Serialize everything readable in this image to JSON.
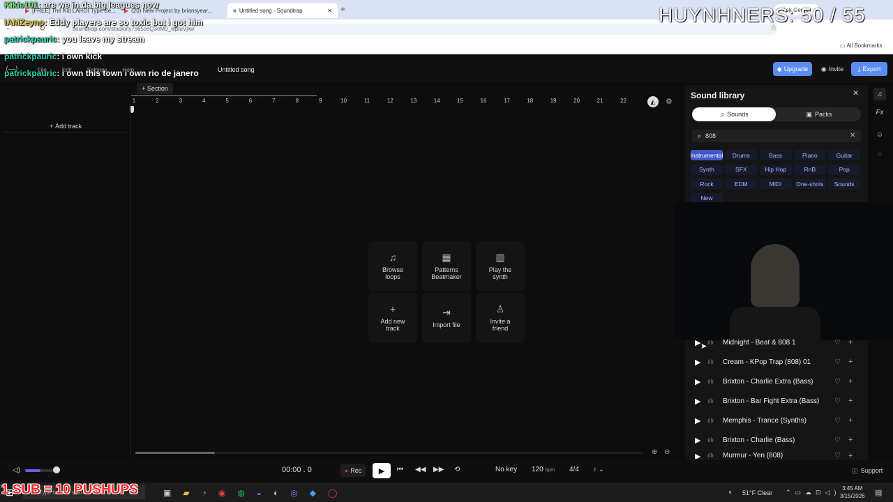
{
  "browser": {
    "tabs": [
      "[FREE] The Kid LAROI Type Be...",
      "(20) New Project by briansyear...",
      "Untitled song - Soundtrap"
    ],
    "url": "soundtrap.com/studio/ly7s65ceQ3eM0_wptuVjiw/",
    "ask_gemini": "Ask Gemini",
    "all_bookmarks": "All Bookmarks"
  },
  "app": {
    "menu": [
      "File",
      "Edit",
      "Settings",
      "Help"
    ],
    "song_title": "Untitled song",
    "upgrade": "Upgrade",
    "invite": "Invite",
    "export": "Export",
    "section": "Section",
    "add_track": "Add track",
    "ruler": [
      "1",
      "2",
      "3",
      "4",
      "5",
      "6",
      "7",
      "8",
      "9",
      "10",
      "11",
      "12",
      "13",
      "14",
      "15",
      "16",
      "17",
      "18",
      "19",
      "20",
      "21",
      "22"
    ],
    "tiles": [
      {
        "icon": "music-note-icon",
        "line1": "Browse",
        "line2": "loops"
      },
      {
        "icon": "grid-icon",
        "line1": "Patterns",
        "line2": "Beatmaker"
      },
      {
        "icon": "keyboard-icon",
        "line1": "Play the",
        "line2": "synth"
      },
      {
        "icon": "plus-icon",
        "line1": "Add new",
        "line2": "track"
      },
      {
        "icon": "import-icon",
        "line1": "Import file",
        "line2": ""
      },
      {
        "icon": "add-person-icon",
        "line1": "Invite a",
        "line2": "friend"
      }
    ]
  },
  "library": {
    "title": "Sound library",
    "tab_sounds": "Sounds",
    "tab_packs": "Packs",
    "search_value": "808",
    "chips": [
      "Instrumental",
      "Drums",
      "Bass",
      "Piano",
      "Guitar",
      "Synth",
      "SFX",
      "Hip Hop",
      "RnB",
      "Pop",
      "Rock",
      "EDM",
      "MIDI",
      "One-shots",
      "Sounds",
      "New"
    ],
    "selected_chip": "Instrumental",
    "items": [
      "Midnight - Beat & 808 1",
      "Cream - KPop Trap (808) 01",
      "Brixton - Charlie Extra (Bass)",
      "Brixton - Bar Fight Extra (Bass)",
      "Memphis - Trance (Synths)",
      "Brixton - Charlie (Bass)",
      "Murmur - Yen (808)"
    ]
  },
  "transport": {
    "time": "00:00 . 0",
    "rec": "Rec",
    "key": "No key",
    "bpm": "120",
    "bpm_unit": "bpm",
    "meter": "4/4",
    "support": "Support"
  },
  "overlay": {
    "chat": [
      {
        "user": "Kikie101",
        "text": ": are we in da big leagues now",
        "color": "#6ee06e"
      },
      {
        "user": "IAMZeyno",
        "text": ": Eddy players are so toxic but i got him",
        "color": "#e0c43a"
      },
      {
        "user": "patrickpauric",
        "text": ": you leave my stream",
        "color": "#28d6b4"
      },
      {
        "user": "patrickpauric",
        "text": ": i own kick",
        "color": "#28d6b4"
      },
      {
        "user": "patrickpauric",
        "text": ": i own this town i own rio de janero",
        "color": "#28d6b4"
      }
    ],
    "counter": "HUYNHNERS: 50 / 55",
    "sub_banner": "1 SUB = 10 PUSHUPS"
  },
  "taskbar": {
    "search": "Type here to search",
    "weather": "51°F  Clear",
    "time": "3:45 AM",
    "date": "3/15/2026"
  },
  "colors": {
    "accent": "#5b8cf5",
    "chip_selected": "#3f58c8",
    "rec": "#e0245e"
  }
}
